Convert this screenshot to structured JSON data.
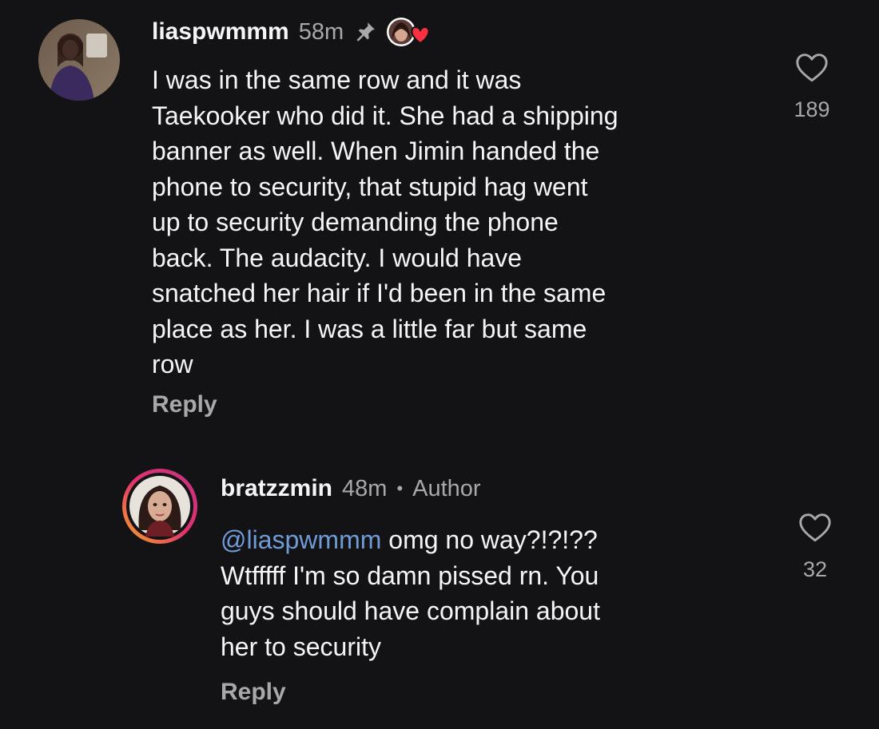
{
  "comments": [
    {
      "username": "liaspwmmm",
      "time": "58m",
      "pinned_icon": "pin-icon",
      "creator_liked_icon": "creator-heart-avatar-icon",
      "lines": [
        "I was in the same row and it was",
        "Taekooker who did it. She had a shipping",
        "banner as well. When Jimin handed the",
        "phone to security, that stupid hag went",
        "up to security demanding the phone",
        "back. The audacity. I would have",
        "snatched her hair if I'd been in the same",
        "place as her. I was a little far but same",
        "row"
      ],
      "reply_label": "Reply",
      "like_icon": "heart-outline-icon",
      "like_count": "189"
    },
    {
      "username": "bratzzmin",
      "time": "48m",
      "separator": "•",
      "author_badge": "Author",
      "mention": "@liaspwmmm",
      "lines": [
        " omg no way?!?!??",
        "Wtfffff I'm so damn pissed rn. You",
        "guys should have complain about",
        "her to security"
      ],
      "reply_label": "Reply",
      "like_icon": "heart-outline-icon",
      "like_count": "32"
    }
  ],
  "colors": {
    "background": "#131316",
    "text": "#f5f5f5",
    "muted": "#a8a8a8",
    "mention": "#6f9bd6",
    "heart_red": "#ff3040",
    "story_ring_start": "#f9a825",
    "story_ring_end": "#c13584"
  }
}
